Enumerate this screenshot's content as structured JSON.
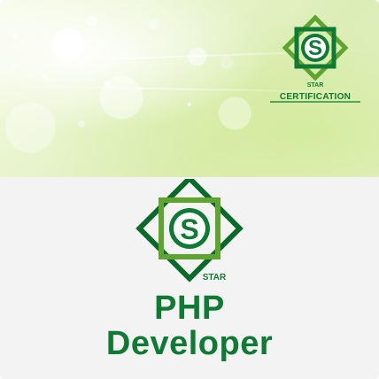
{
  "brand": {
    "logo_letter": "S",
    "logo_word": "STAR",
    "certification_text": "CERTIFICATION"
  },
  "course": {
    "title_line1": "PHP",
    "title_line2": "Developer"
  },
  "colors": {
    "brand_green": "#0f7a33",
    "dark_green": "#0a6a2a",
    "light_green": "#5ea52f",
    "lime_background": "#dcedb6",
    "panel_gray": "#f3f3f3"
  },
  "icons": {
    "hero_logo": "star-certification-logo",
    "main_logo": "star-logo"
  }
}
